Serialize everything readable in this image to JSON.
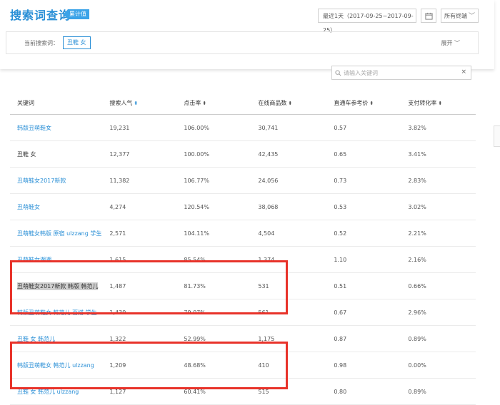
{
  "page": {
    "title": "搜索词查询",
    "badge": "累计值"
  },
  "date_range": "最近1天（2017-09-25~2017-09-25）",
  "terminal_dropdown": "所有终端",
  "filter": {
    "label": "当前搜索词：",
    "current_term": "丑鞋 女",
    "expand_label": "展开"
  },
  "search": {
    "placeholder": "请输入关键词",
    "clear": "×"
  },
  "table": {
    "columns": [
      "关键词",
      "搜索人气",
      "点击率",
      "在线商品数",
      "直通车参考价",
      "支付转化率"
    ],
    "rows": [
      [
        "韩版丑萌鞋女",
        "19,231",
        "106.00%",
        "30,741",
        "0.57",
        "3.82%"
      ],
      [
        "丑鞋 女",
        "12,377",
        "100.00%",
        "42,435",
        "0.65",
        "3.41%"
      ],
      [
        "丑萌鞋女2017新款",
        "11,382",
        "106.77%",
        "24,056",
        "0.73",
        "2.83%"
      ],
      [
        "丑萌鞋女",
        "4,274",
        "120.54%",
        "38,068",
        "0.53",
        "3.02%"
      ],
      [
        "丑萌鞋女韩版 原宿 ulzzang 学生",
        "2,571",
        "104.11%",
        "4,504",
        "0.52",
        "2.21%"
      ],
      [
        "丑萌鞋女潮潮",
        "1,615",
        "85.54%",
        "1,374",
        "1.10",
        "2.16%"
      ],
      [
        "丑萌鞋女2017新款 韩版 韩范儿",
        "1,487",
        "81.73%",
        "531",
        "0.51",
        "0.66%"
      ],
      [
        "韩版丑萌鞋女 韩范儿 百搭 学生",
        "1,439",
        "79.07%",
        "561",
        "0.67",
        "2.96%"
      ],
      [
        "丑鞋 女 韩范儿",
        "1,322",
        "52.99%",
        "1,175",
        "0.87",
        "0.89%"
      ],
      [
        "韩版丑萌鞋女 韩范儿 ulzzang",
        "1,209",
        "48.68%",
        "410",
        "0.98",
        "0.00%"
      ],
      [
        "丑鞋 女 韩范儿 ulzzang",
        "1,127",
        "60.41%",
        "515",
        "0.80",
        "0.89%"
      ]
    ]
  }
}
